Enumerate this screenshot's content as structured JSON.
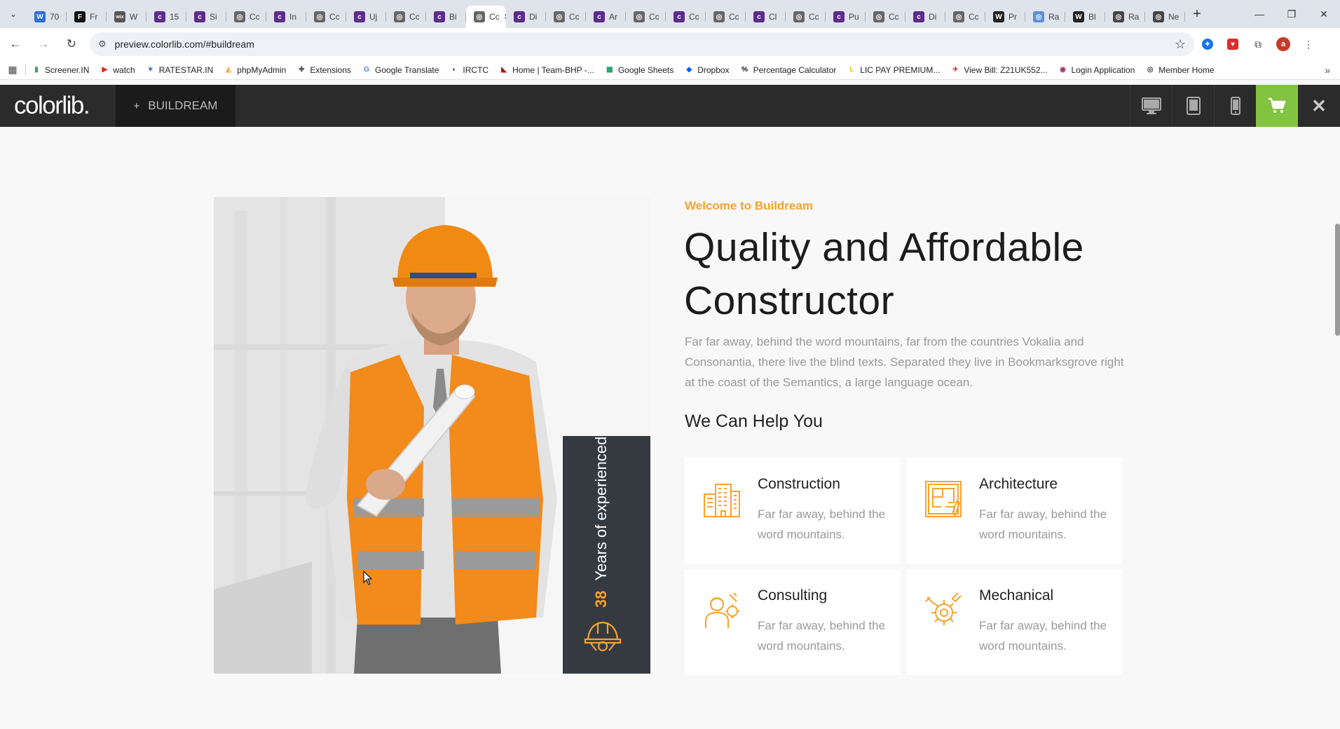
{
  "browser": {
    "tabs": [
      {
        "label": "70",
        "color": "#2b6de0",
        "glyph": "W"
      },
      {
        "label": "Fr",
        "color": "#111111",
        "glyph": "F"
      },
      {
        "label": "W",
        "color": "#555555",
        "glyph": "wix"
      },
      {
        "label": "15",
        "color": "#5b2c8a",
        "glyph": "c"
      },
      {
        "label": "Si",
        "color": "#5b2c8a",
        "glyph": "c"
      },
      {
        "label": "Cc",
        "color": "#666666",
        "glyph": "◎"
      },
      {
        "label": "In",
        "color": "#5b2c8a",
        "glyph": "c"
      },
      {
        "label": "Cc",
        "color": "#666666",
        "glyph": "◎"
      },
      {
        "label": "Uj",
        "color": "#5b2c8a",
        "glyph": "c"
      },
      {
        "label": "Cc",
        "color": "#666666",
        "glyph": "◎"
      },
      {
        "label": "Bi",
        "color": "#5b2c8a",
        "glyph": "c"
      },
      {
        "label": "Cc",
        "color": "#666666",
        "glyph": "◎",
        "active": true
      },
      {
        "label": "Di",
        "color": "#5b2c8a",
        "glyph": "c"
      },
      {
        "label": "Cc",
        "color": "#666666",
        "glyph": "◎"
      },
      {
        "label": "Ar",
        "color": "#5b2c8a",
        "glyph": "c"
      },
      {
        "label": "Cc",
        "color": "#666666",
        "glyph": "◎"
      },
      {
        "label": "Cc",
        "color": "#5b2c8a",
        "glyph": "c"
      },
      {
        "label": "Cc",
        "color": "#666666",
        "glyph": "◎"
      },
      {
        "label": "Cl",
        "color": "#5b2c8a",
        "glyph": "c"
      },
      {
        "label": "Cc",
        "color": "#666666",
        "glyph": "◎"
      },
      {
        "label": "Pu",
        "color": "#5b2c8a",
        "glyph": "c"
      },
      {
        "label": "Cc",
        "color": "#666666",
        "glyph": "◎"
      },
      {
        "label": "Di",
        "color": "#5b2c8a",
        "glyph": "c"
      },
      {
        "label": "Cc",
        "color": "#666666",
        "glyph": "◎"
      },
      {
        "label": "Pr",
        "color": "#222222",
        "glyph": "W"
      },
      {
        "label": "Ra",
        "color": "#5a8fd6",
        "glyph": "◎"
      },
      {
        "label": "Bl",
        "color": "#222222",
        "glyph": "W"
      },
      {
        "label": "Ra",
        "color": "#444444",
        "glyph": "◎"
      },
      {
        "label": "Ne",
        "color": "#444444",
        "glyph": "◎"
      }
    ],
    "address_url": "preview.colorlib.com/#buildream",
    "bookmarks": [
      {
        "label": "Screener.IN",
        "icon": "bar-chart-icon",
        "color": "#3aa757",
        "glyph": "▮"
      },
      {
        "label": "watch",
        "icon": "youtube-icon",
        "color": "#e62117",
        "glyph": "▶"
      },
      {
        "label": "RATESTAR.IN",
        "icon": "star-icon",
        "color": "#3a6fb0",
        "glyph": "✶"
      },
      {
        "label": "phpMyAdmin",
        "icon": "phpmyadmin-icon",
        "color": "#f0a030",
        "glyph": "◭"
      },
      {
        "label": "Extensions",
        "icon": "puzzle-icon",
        "color": "#555555",
        "glyph": "✚"
      },
      {
        "label": "Google Translate",
        "icon": "translate-icon",
        "color": "#4285f4",
        "glyph": "G"
      },
      {
        "label": "IRCTC",
        "icon": "irctc-icon",
        "color": "#1d4f91",
        "glyph": "◐"
      },
      {
        "label": "Home | Team-BHP -...",
        "icon": "teambhp-icon",
        "color": "#b31010",
        "glyph": "◣"
      },
      {
        "label": "Google Sheets",
        "icon": "sheets-icon",
        "color": "#0f9d58",
        "glyph": "▦"
      },
      {
        "label": "Dropbox",
        "icon": "dropbox-icon",
        "color": "#0061fe",
        "glyph": "◆"
      },
      {
        "label": "Percentage Calculator",
        "icon": "calculator-icon",
        "color": "#111111",
        "glyph": "%"
      },
      {
        "label": "LIC PAY PREMIUM...",
        "icon": "lic-icon",
        "color": "#f2c200",
        "glyph": "L"
      },
      {
        "label": "View Bill: Z21UK552...",
        "icon": "bill-icon",
        "color": "#cc3333",
        "glyph": "✈"
      },
      {
        "label": "Login Application",
        "icon": "login-icon",
        "color": "#a03060",
        "glyph": "◉"
      },
      {
        "label": "Member Home",
        "icon": "globe-icon",
        "color": "#444444",
        "glyph": "◎"
      }
    ],
    "profile_initial": "a"
  },
  "preview": {
    "logo": "colorlib",
    "logo_dot": ".",
    "theme_name": "BUILDREAM",
    "plus": "+",
    "close": "✕",
    "accent": "#82c341"
  },
  "hero": {
    "subtitle": "Welcome to Buildream",
    "headline": "Quality and Affordable Constructor",
    "intro": "Far far away, behind the word mountains, far from the countries Vokalia and Consonantia, there live the blind texts. Separated they live in Bookmarksgrove right at the coast of the Semantics, a large language ocean.",
    "help_heading": "We Can Help You",
    "experience_number": "38",
    "experience_label": "Years of experienced",
    "accent": "#f7a22d",
    "services": [
      {
        "title": "Construction",
        "text": "Far far away, behind the word mountains.",
        "icon": "buildings-icon"
      },
      {
        "title": "Architecture",
        "text": "Far far away, behind the word mountains.",
        "icon": "blueprint-icon"
      },
      {
        "title": "Consulting",
        "text": "Far far away, behind the word mountains.",
        "icon": "consultant-icon"
      },
      {
        "title": "Mechanical",
        "text": "Far far away, behind the word mountains.",
        "icon": "gears-icon"
      }
    ]
  }
}
